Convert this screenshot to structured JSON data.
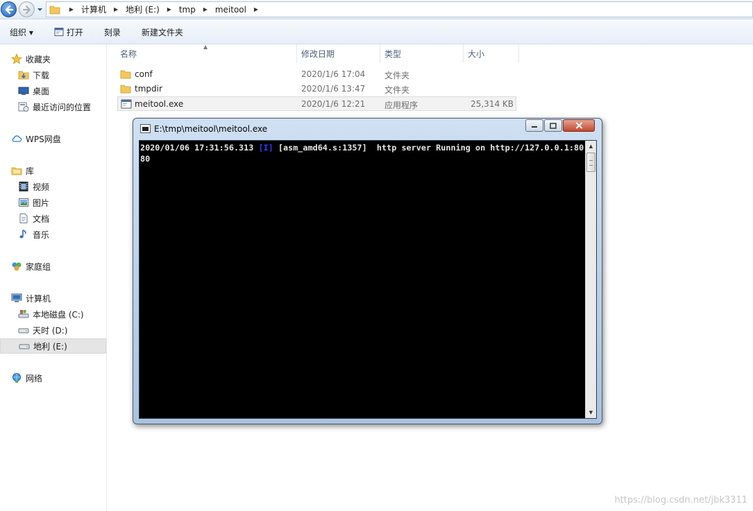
{
  "address_bar": {
    "crumbs": [
      "计算机",
      "地利 (E:)",
      "tmp",
      "meitool"
    ]
  },
  "toolbar": {
    "organize_label": "组织 ▾",
    "open_label": "打开",
    "burn_label": "刻录",
    "new_folder_label": "新建文件夹"
  },
  "sidebar": {
    "favorites": {
      "title": "收藏夹",
      "items": [
        "下载",
        "桌面",
        "最近访问的位置"
      ]
    },
    "wps_label": "WPS网盘",
    "libraries": {
      "title": "库",
      "items": [
        "视频",
        "图片",
        "文档",
        "音乐"
      ]
    },
    "homegroup_label": "家庭组",
    "computer": {
      "title": "计算机",
      "drives": [
        "本地磁盘 (C:)",
        "天时 (D:)",
        "地利 (E:)"
      ]
    },
    "network_label": "网络"
  },
  "file_list": {
    "columns": [
      "名称",
      "修改日期",
      "类型",
      "大小"
    ],
    "rows": [
      {
        "name": "conf",
        "modified": "2020/1/6 17:04",
        "type": "文件夹",
        "size": ""
      },
      {
        "name": "tmpdir",
        "modified": "2020/1/6 13:47",
        "type": "文件夹",
        "size": ""
      },
      {
        "name": "meitool.exe",
        "modified": "2020/1/6 12:21",
        "type": "应用程序",
        "size": "25,314 KB"
      }
    ]
  },
  "console": {
    "title": "E:\\tmp\\meitool\\meitool.exe",
    "log_prefix": "2020/01/06 17:31:56.313 ",
    "log_level": "[I]",
    "log_rest": " [asm_amd64.s:1357]  http server Running on http://127.0.0.1:8080"
  },
  "watermark": "https://blog.csdn.net/jbk3311",
  "colors": {
    "log_level": "#2b3cff",
    "console_bg": "#000000",
    "selection": "#e5e5e5"
  }
}
